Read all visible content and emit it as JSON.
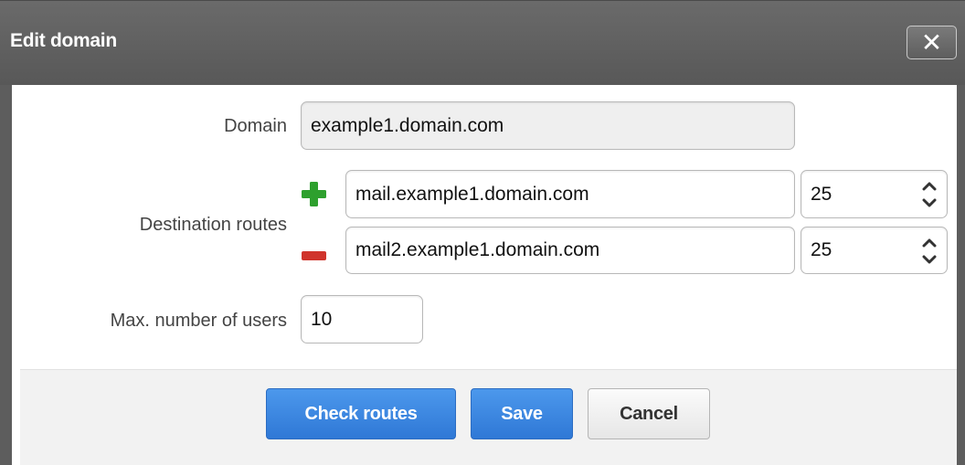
{
  "dialog": {
    "title": "Edit domain",
    "close_symbol": "✕"
  },
  "form": {
    "domain_label": "Domain",
    "domain_value": "example1.domain.com",
    "routes_label": "Destination routes",
    "routes": [
      {
        "host": "mail.example1.domain.com",
        "port": "25",
        "action_icon": "plus-icon"
      },
      {
        "host": "mail2.example1.domain.com",
        "port": "25",
        "action_icon": "minus-icon"
      }
    ],
    "max_users_label": "Max. number of users",
    "max_users_value": "10"
  },
  "buttons": {
    "check_routes": "Check routes",
    "save": "Save",
    "cancel": "Cancel"
  },
  "colors": {
    "title_bar": "#5e5e5e",
    "primary_button": "#3b87e0",
    "plus_icon": "#2ea02e",
    "minus_icon": "#d0342c"
  }
}
